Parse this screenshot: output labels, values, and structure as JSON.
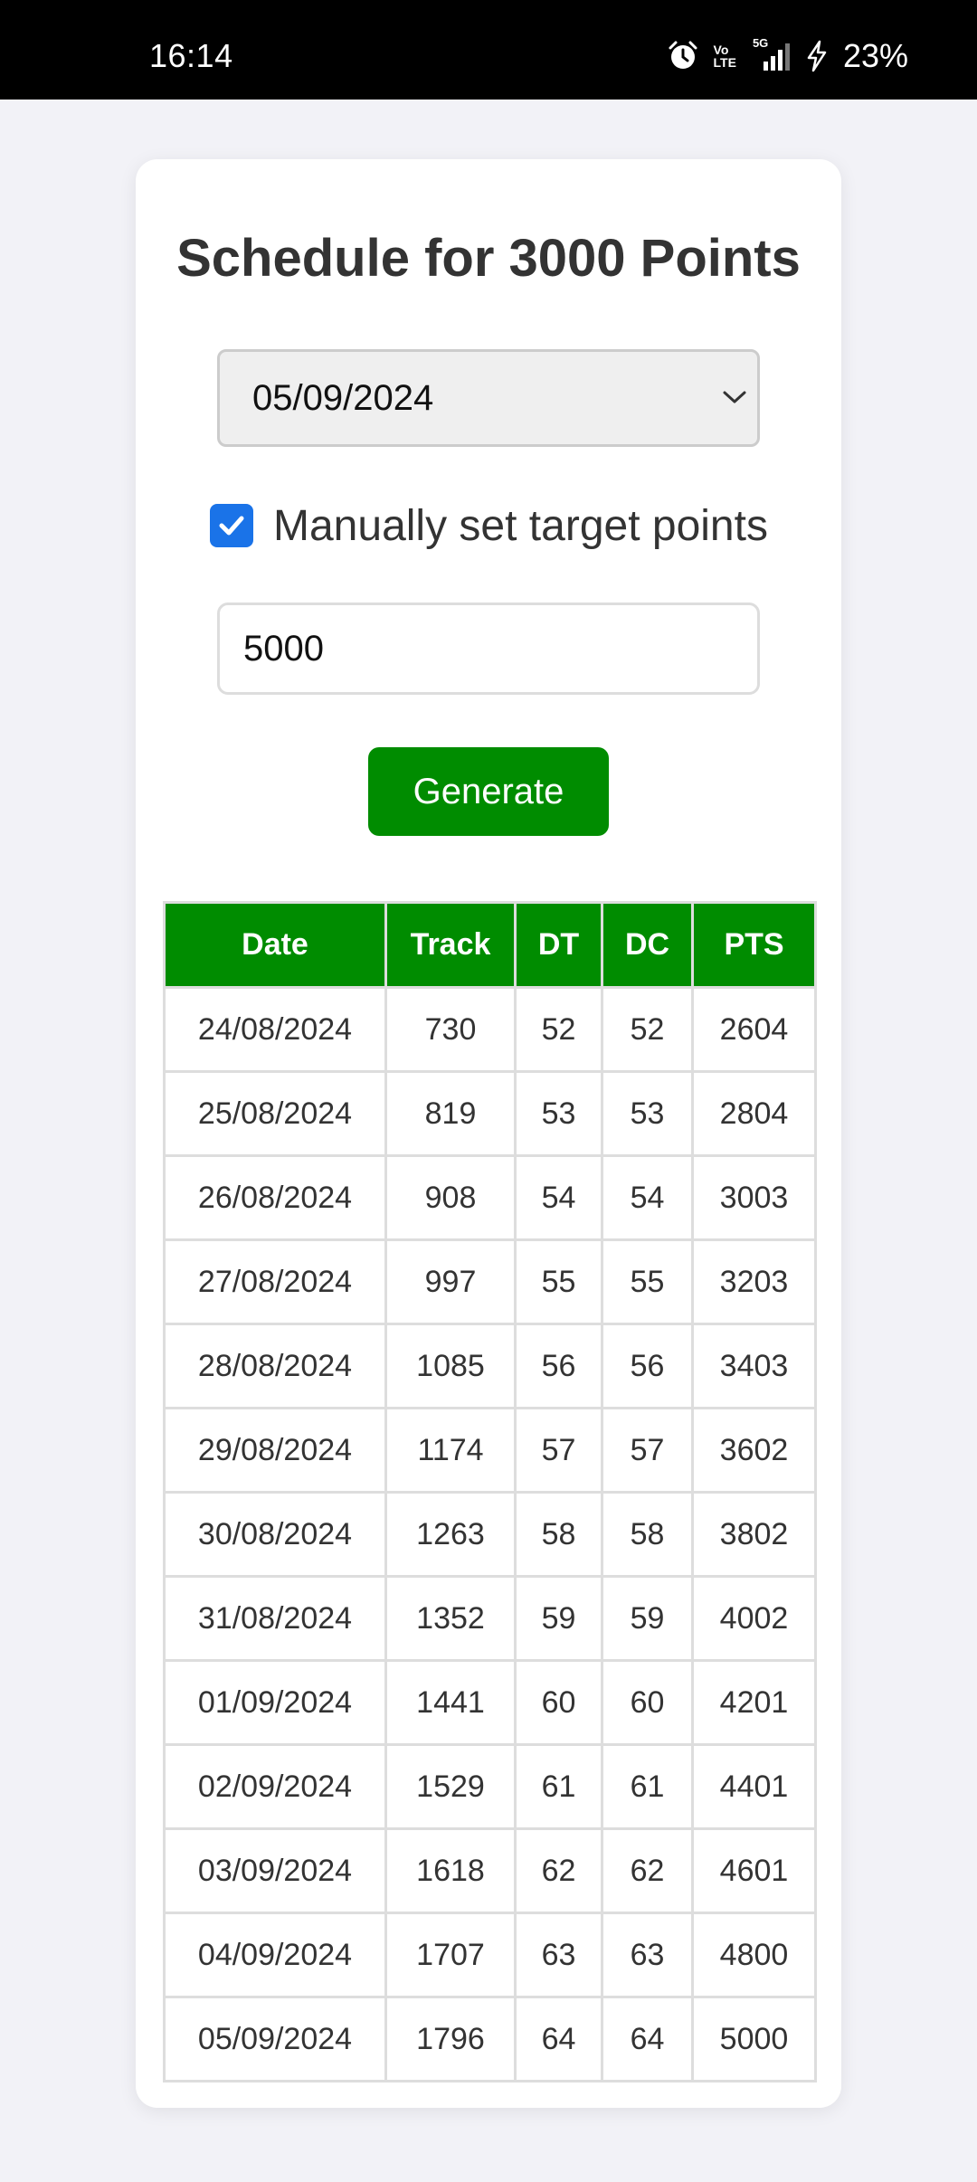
{
  "status_bar": {
    "time": "16:14",
    "volte_line1": "Vo",
    "volte_line2": "LTE",
    "network": "5G",
    "battery": "23%"
  },
  "page": {
    "title": "Schedule for 3000 Points",
    "date_select": {
      "value": "05/09/2024"
    },
    "manual_checkbox": {
      "checked": true,
      "label": "Manually set target points"
    },
    "target_input": {
      "value": "5000"
    },
    "generate_label": "Generate"
  },
  "table": {
    "headers": [
      "Date",
      "Track",
      "DT",
      "DC",
      "PTS"
    ],
    "rows": [
      [
        "24/08/2024",
        "730",
        "52",
        "52",
        "2604"
      ],
      [
        "25/08/2024",
        "819",
        "53",
        "53",
        "2804"
      ],
      [
        "26/08/2024",
        "908",
        "54",
        "54",
        "3003"
      ],
      [
        "27/08/2024",
        "997",
        "55",
        "55",
        "3203"
      ],
      [
        "28/08/2024",
        "1085",
        "56",
        "56",
        "3403"
      ],
      [
        "29/08/2024",
        "1174",
        "57",
        "57",
        "3602"
      ],
      [
        "30/08/2024",
        "1263",
        "58",
        "58",
        "3802"
      ],
      [
        "31/08/2024",
        "1352",
        "59",
        "59",
        "4002"
      ],
      [
        "01/09/2024",
        "1441",
        "60",
        "60",
        "4201"
      ],
      [
        "02/09/2024",
        "1529",
        "61",
        "61",
        "4401"
      ],
      [
        "03/09/2024",
        "1618",
        "62",
        "62",
        "4601"
      ],
      [
        "04/09/2024",
        "1707",
        "63",
        "63",
        "4800"
      ],
      [
        "05/09/2024",
        "1796",
        "64",
        "64",
        "5000"
      ]
    ]
  },
  "colors": {
    "accent_green": "#008c00",
    "checkbox_blue": "#1a73e8",
    "page_background": "#f2f2f7"
  },
  "icons": {
    "status": [
      "alarm-icon",
      "signal-icon",
      "charging-icon"
    ],
    "select": "chevron-down-icon",
    "checkbox": "checkmark-icon"
  }
}
